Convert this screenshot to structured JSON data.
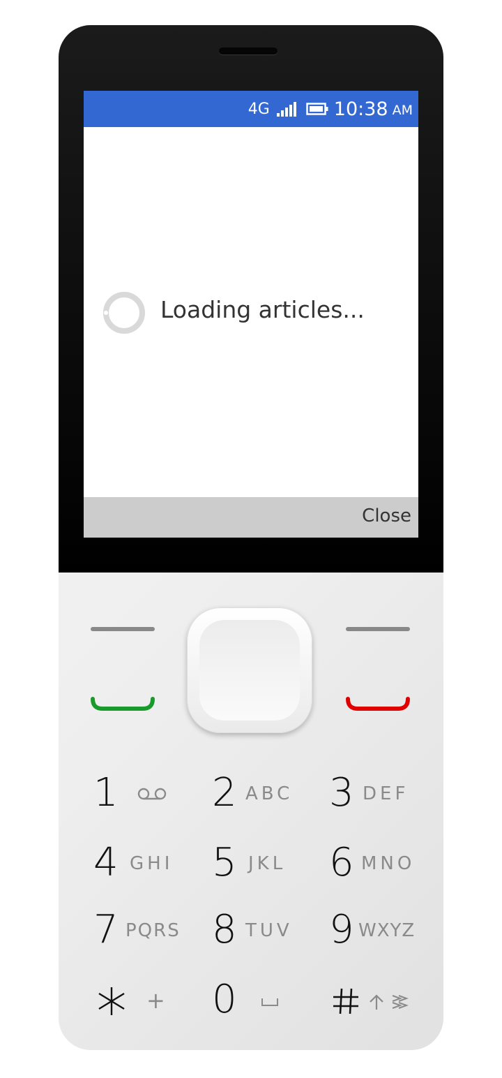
{
  "statusbar": {
    "network": "4G",
    "time": "10:38",
    "ampm": "AM",
    "signal_icon": "signal-bars-icon",
    "battery_icon": "battery-icon"
  },
  "content": {
    "loading_text": "Loading articles...",
    "loader_icon": "spinner-icon"
  },
  "softkeys": {
    "right": "Close"
  },
  "keypad": {
    "keys": [
      {
        "digit": "1",
        "letters": "",
        "icon": "voicemail-icon"
      },
      {
        "digit": "2",
        "letters": "ABC"
      },
      {
        "digit": "3",
        "letters": "DEF"
      },
      {
        "digit": "4",
        "letters": "GHI"
      },
      {
        "digit": "5",
        "letters": "JKL"
      },
      {
        "digit": "6",
        "letters": "MNO"
      },
      {
        "digit": "7",
        "letters": "PQRS"
      },
      {
        "digit": "8",
        "letters": "TUV"
      },
      {
        "digit": "9",
        "letters": "WXYZ"
      },
      {
        "digit": "*",
        "letters": "+",
        "icon": "asterisk-icon"
      },
      {
        "digit": "0",
        "letters": "",
        "icon": "space-icon"
      },
      {
        "digit": "#",
        "letters": "",
        "icon": "hash-icon"
      }
    ]
  },
  "colors": {
    "statusbar_bg": "#3367d1",
    "softkey_bg": "#cccccc",
    "call_green": "#1a9a2b",
    "end_red": "#e00000"
  }
}
